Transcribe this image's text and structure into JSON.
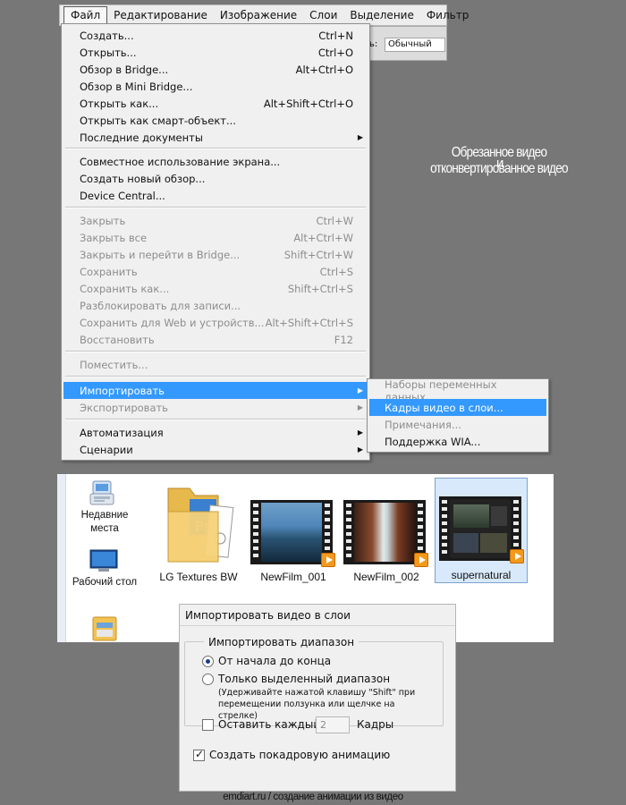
{
  "menubar": {
    "items": [
      "Файл",
      "Редактирование",
      "Изображение",
      "Слои",
      "Выделение",
      "Фильтр"
    ],
    "options_label": "ь:",
    "options_select": "Обычный"
  },
  "file_menu": {
    "items": [
      {
        "label": "Создать...",
        "shortcut": "Ctrl+N"
      },
      {
        "label": "Открыть...",
        "shortcut": "Ctrl+O"
      },
      {
        "label": "Обзор в Bridge...",
        "shortcut": "Alt+Ctrl+O"
      },
      {
        "label": "Обзор в Mini Bridge...",
        "shortcut": ""
      },
      {
        "label": "Открыть как...",
        "shortcut": "Alt+Shift+Ctrl+O"
      },
      {
        "label": "Открыть как смарт-объект...",
        "shortcut": ""
      },
      {
        "label": "Последние документы",
        "shortcut": ""
      },
      {
        "label": "Совместное использование экрана...",
        "shortcut": ""
      },
      {
        "label": "Создать новый обзор...",
        "shortcut": ""
      },
      {
        "label": "Device Central...",
        "shortcut": ""
      },
      {
        "label": "Закрыть",
        "shortcut": "Ctrl+W"
      },
      {
        "label": "Закрыть все",
        "shortcut": "Alt+Ctrl+W"
      },
      {
        "label": "Закрыть и перейти в Bridge...",
        "shortcut": "Shift+Ctrl+W"
      },
      {
        "label": "Сохранить",
        "shortcut": "Ctrl+S"
      },
      {
        "label": "Сохранить как...",
        "shortcut": "Shift+Ctrl+S"
      },
      {
        "label": "Разблокировать для записи...",
        "shortcut": ""
      },
      {
        "label": "Сохранить для Web и устройств...",
        "shortcut": "Alt+Shift+Ctrl+S"
      },
      {
        "label": "Восстановить",
        "shortcut": "F12"
      },
      {
        "label": "Поместить...",
        "shortcut": ""
      },
      {
        "label": "Импортировать",
        "shortcut": ""
      },
      {
        "label": "Экспортировать",
        "shortcut": ""
      },
      {
        "label": "Автоматизация",
        "shortcut": ""
      },
      {
        "label": "Сценарии",
        "shortcut": ""
      }
    ]
  },
  "import_submenu": {
    "items": [
      "Наборы переменных данных...",
      "Кадры видео в слои...",
      "Примечания...",
      "Поддержка WIA..."
    ]
  },
  "caption": {
    "line1": "Обрезанное видео",
    "overlap": "и",
    "line2": "отконвертированное видео"
  },
  "explorer": {
    "nav": [
      "Недавние места",
      "Рабочий стол"
    ],
    "files": [
      "LG Textures BW",
      "NewFilm_001",
      "NewFilm_002",
      "supernatural"
    ]
  },
  "dialog": {
    "title": "Импортировать видео в слои",
    "group_label": "Импортировать диапазон",
    "radio_all": "От начала до конца",
    "radio_selected": "Только выделенный диапазон",
    "note": "(Удерживайте нажатой клавишу \"Shift\" при перемещении ползунка или щелчке на стрелке)",
    "limit_label": "Оставить каждый",
    "limit_value": "2",
    "limit_unit": "Кадры",
    "animation_label": "Создать покадровую анимацию"
  },
  "footer": "emdiart.ru / создание анимации из видео"
}
